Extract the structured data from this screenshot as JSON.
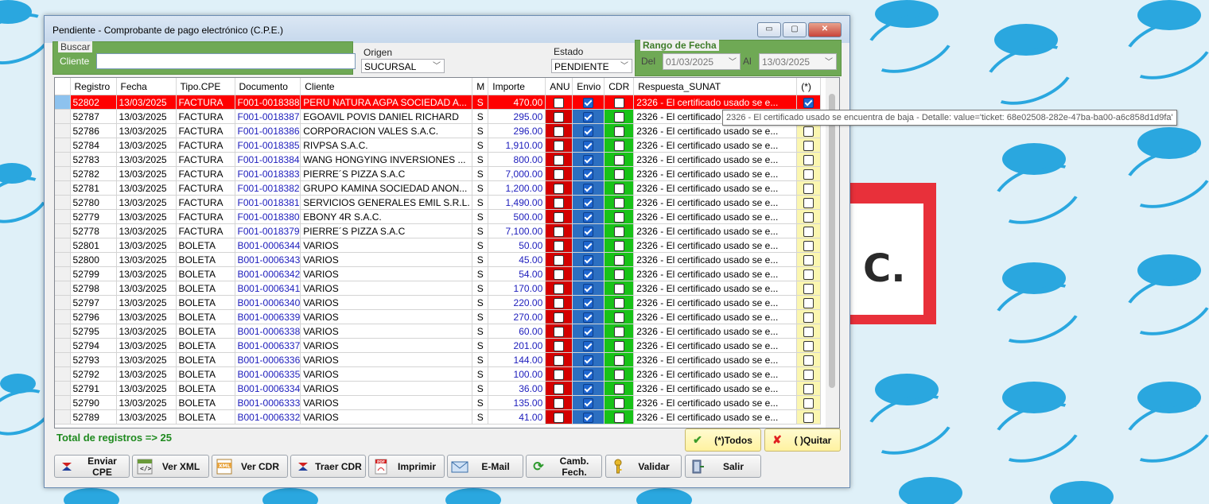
{
  "window": {
    "title": "Pendiente - Comprobante de pago electrónico (C.P.E.)",
    "min_glyph": "▭",
    "max_glyph": "▢",
    "close_glyph": "✕"
  },
  "filters": {
    "buscar_legend": "Buscar",
    "cliente_label": "Cliente",
    "cliente_value": "",
    "origen_label": "Origen",
    "origen_value": "SUCURSAL",
    "estado_label": "Estado",
    "estado_value": "PENDIENTE",
    "rango_legend": "Rango de Fecha",
    "del_label": "Del",
    "del_value": "01/03/2025",
    "al_label": "Al",
    "al_value": "13/03/2025"
  },
  "grid": {
    "columns": [
      "Registro",
      "Fecha",
      "Tipo.CPE",
      "Documento",
      "Cliente",
      "M",
      "Importe",
      "ANU",
      "Envio",
      "CDR",
      "Respuesta_SUNAT",
      "(*)"
    ],
    "rows": [
      {
        "registro": "52802",
        "fecha": "13/03/2025",
        "tipo": "FACTURA",
        "documento": "F001-0018388",
        "cliente": "PERU NATURA AGPA SOCIEDAD A...",
        "m": "S",
        "importe": "470.00",
        "anu": false,
        "envio": true,
        "cdr": false,
        "respuesta": "2326 - El certificado usado se e...",
        "sel": true
      },
      {
        "registro": "52787",
        "fecha": "13/03/2025",
        "tipo": "FACTURA",
        "documento": "F001-0018387",
        "cliente": "EGOAVIL POVIS DANIEL RICHARD",
        "m": "S",
        "importe": "295.00",
        "anu": false,
        "envio": true,
        "cdr": false,
        "respuesta": "2326 - El certificado",
        "sel": false
      },
      {
        "registro": "52786",
        "fecha": "13/03/2025",
        "tipo": "FACTURA",
        "documento": "F001-0018386",
        "cliente": "CORPORACION VALES S.A.C.",
        "m": "S",
        "importe": "296.00",
        "anu": false,
        "envio": true,
        "cdr": false,
        "respuesta": "2326 - El certificado usado se e...",
        "sel": false
      },
      {
        "registro": "52784",
        "fecha": "13/03/2025",
        "tipo": "FACTURA",
        "documento": "F001-0018385",
        "cliente": "RIVPSA S.A.C.",
        "m": "S",
        "importe": "1,910.00",
        "anu": false,
        "envio": true,
        "cdr": false,
        "respuesta": "2326 - El certificado usado se e...",
        "sel": false
      },
      {
        "registro": "52783",
        "fecha": "13/03/2025",
        "tipo": "FACTURA",
        "documento": "F001-0018384",
        "cliente": "WANG HONGYING INVERSIONES ...",
        "m": "S",
        "importe": "800.00",
        "anu": false,
        "envio": true,
        "cdr": false,
        "respuesta": "2326 - El certificado usado se e...",
        "sel": false
      },
      {
        "registro": "52782",
        "fecha": "13/03/2025",
        "tipo": "FACTURA",
        "documento": "F001-0018383",
        "cliente": "PIERRE´S PIZZA S.A.C",
        "m": "S",
        "importe": "7,000.00",
        "anu": false,
        "envio": true,
        "cdr": false,
        "respuesta": "2326 - El certificado usado se e...",
        "sel": false
      },
      {
        "registro": "52781",
        "fecha": "13/03/2025",
        "tipo": "FACTURA",
        "documento": "F001-0018382",
        "cliente": "GRUPO KAMINA SOCIEDAD ANON...",
        "m": "S",
        "importe": "1,200.00",
        "anu": false,
        "envio": true,
        "cdr": false,
        "respuesta": "2326 - El certificado usado se e...",
        "sel": false
      },
      {
        "registro": "52780",
        "fecha": "13/03/2025",
        "tipo": "FACTURA",
        "documento": "F001-0018381",
        "cliente": "SERVICIOS GENERALES EMIL S.R.L.",
        "m": "S",
        "importe": "1,490.00",
        "anu": false,
        "envio": true,
        "cdr": false,
        "respuesta": "2326 - El certificado usado se e...",
        "sel": false
      },
      {
        "registro": "52779",
        "fecha": "13/03/2025",
        "tipo": "FACTURA",
        "documento": "F001-0018380",
        "cliente": "EBONY 4R S.A.C.",
        "m": "S",
        "importe": "500.00",
        "anu": false,
        "envio": true,
        "cdr": false,
        "respuesta": "2326 - El certificado usado se e...",
        "sel": false
      },
      {
        "registro": "52778",
        "fecha": "13/03/2025",
        "tipo": "FACTURA",
        "documento": "F001-0018379",
        "cliente": "PIERRE´S PIZZA S.A.C",
        "m": "S",
        "importe": "7,100.00",
        "anu": false,
        "envio": true,
        "cdr": false,
        "respuesta": "2326 - El certificado usado se e...",
        "sel": false
      },
      {
        "registro": "52801",
        "fecha": "13/03/2025",
        "tipo": "BOLETA",
        "documento": "B001-0006344",
        "cliente": "VARIOS",
        "m": "S",
        "importe": "50.00",
        "anu": false,
        "envio": true,
        "cdr": false,
        "respuesta": "2326 - El certificado usado se e...",
        "sel": false
      },
      {
        "registro": "52800",
        "fecha": "13/03/2025",
        "tipo": "BOLETA",
        "documento": "B001-0006343",
        "cliente": "VARIOS",
        "m": "S",
        "importe": "45.00",
        "anu": false,
        "envio": true,
        "cdr": false,
        "respuesta": "2326 - El certificado usado se e...",
        "sel": false
      },
      {
        "registro": "52799",
        "fecha": "13/03/2025",
        "tipo": "BOLETA",
        "documento": "B001-0006342",
        "cliente": "VARIOS",
        "m": "S",
        "importe": "54.00",
        "anu": false,
        "envio": true,
        "cdr": false,
        "respuesta": "2326 - El certificado usado se e...",
        "sel": false
      },
      {
        "registro": "52798",
        "fecha": "13/03/2025",
        "tipo": "BOLETA",
        "documento": "B001-0006341",
        "cliente": "VARIOS",
        "m": "S",
        "importe": "170.00",
        "anu": false,
        "envio": true,
        "cdr": false,
        "respuesta": "2326 - El certificado usado se e...",
        "sel": false
      },
      {
        "registro": "52797",
        "fecha": "13/03/2025",
        "tipo": "BOLETA",
        "documento": "B001-0006340",
        "cliente": "VARIOS",
        "m": "S",
        "importe": "220.00",
        "anu": false,
        "envio": true,
        "cdr": false,
        "respuesta": "2326 - El certificado usado se e...",
        "sel": false
      },
      {
        "registro": "52796",
        "fecha": "13/03/2025",
        "tipo": "BOLETA",
        "documento": "B001-0006339",
        "cliente": "VARIOS",
        "m": "S",
        "importe": "270.00",
        "anu": false,
        "envio": true,
        "cdr": false,
        "respuesta": "2326 - El certificado usado se e...",
        "sel": false
      },
      {
        "registro": "52795",
        "fecha": "13/03/2025",
        "tipo": "BOLETA",
        "documento": "B001-0006338",
        "cliente": "VARIOS",
        "m": "S",
        "importe": "60.00",
        "anu": false,
        "envio": true,
        "cdr": false,
        "respuesta": "2326 - El certificado usado se e...",
        "sel": false
      },
      {
        "registro": "52794",
        "fecha": "13/03/2025",
        "tipo": "BOLETA",
        "documento": "B001-0006337",
        "cliente": "VARIOS",
        "m": "S",
        "importe": "201.00",
        "anu": false,
        "envio": true,
        "cdr": false,
        "respuesta": "2326 - El certificado usado se e...",
        "sel": false
      },
      {
        "registro": "52793",
        "fecha": "13/03/2025",
        "tipo": "BOLETA",
        "documento": "B001-0006336",
        "cliente": "VARIOS",
        "m": "S",
        "importe": "144.00",
        "anu": false,
        "envio": true,
        "cdr": false,
        "respuesta": "2326 - El certificado usado se e...",
        "sel": false
      },
      {
        "registro": "52792",
        "fecha": "13/03/2025",
        "tipo": "BOLETA",
        "documento": "B001-0006335",
        "cliente": "VARIOS",
        "m": "S",
        "importe": "100.00",
        "anu": false,
        "envio": true,
        "cdr": false,
        "respuesta": "2326 - El certificado usado se e...",
        "sel": false
      },
      {
        "registro": "52791",
        "fecha": "13/03/2025",
        "tipo": "BOLETA",
        "documento": "B001-0006334",
        "cliente": "VARIOS",
        "m": "S",
        "importe": "36.00",
        "anu": false,
        "envio": true,
        "cdr": false,
        "respuesta": "2326 - El certificado usado se e...",
        "sel": false
      },
      {
        "registro": "52790",
        "fecha": "13/03/2025",
        "tipo": "BOLETA",
        "documento": "B001-0006333",
        "cliente": "VARIOS",
        "m": "S",
        "importe": "135.00",
        "anu": false,
        "envio": true,
        "cdr": false,
        "respuesta": "2326 - El certificado usado se e...",
        "sel": false
      },
      {
        "registro": "52789",
        "fecha": "13/03/2025",
        "tipo": "BOLETA",
        "documento": "B001-0006332",
        "cliente": "VARIOS",
        "m": "S",
        "importe": "41.00",
        "anu": false,
        "envio": true,
        "cdr": false,
        "respuesta": "2326 - El certificado usado se e...",
        "sel": false
      }
    ]
  },
  "tooltip": "2326 - El certificado usado se encuentra de baja - Detalle: value='ticket: 68e02508-282e-47ba-ba00-a6c858d1d9fa'",
  "footer": {
    "total_label": "Total de registros => 25",
    "todos_label": "(*)Todos",
    "quitar_label": "( )Quitar",
    "enviar_label": "Enviar CPE",
    "verxml_label": "Ver XML",
    "vercdr_label": "Ver CDR",
    "traercdr_label": "Traer CDR",
    "imprimir_label": "Imprimir",
    "email_label": "E-Mail",
    "cambfech_label": "Camb. Fech.",
    "validar_label": "Validar",
    "salir_label": "Salir",
    "xml_badge": "XML",
    "pdf_badge": "PDF"
  },
  "wallpaper": {
    "logo_letter": "C."
  },
  "colors": {
    "anu": "#d40000",
    "envio": "#2c6fc1",
    "cdr": "#18c218",
    "selected_row": "#ff0000",
    "total_text": "#1f8a1f"
  }
}
